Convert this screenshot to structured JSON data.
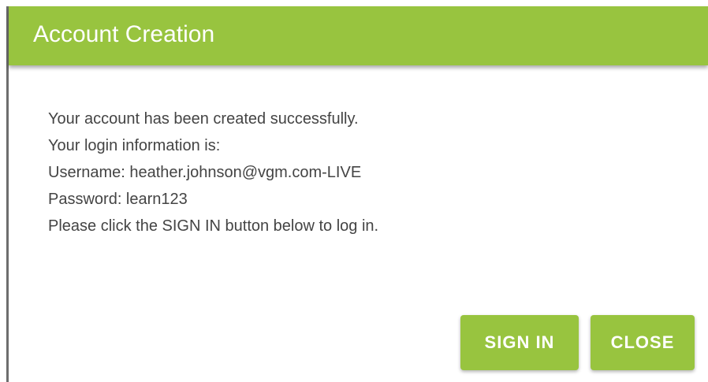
{
  "dialog": {
    "title": "Account Creation",
    "lines": [
      "Your account has been created successfully.",
      "Your login information is:",
      "Username: heather.johnson@vgm.com-LIVE",
      "Password: learn123",
      "Please click the SIGN IN button below to log in."
    ],
    "buttons": {
      "sign_in": "SIGN IN",
      "close": "CLOSE"
    }
  },
  "colors": {
    "header": "#98c43f",
    "button": "#98c43f",
    "body_text": "#444444"
  }
}
